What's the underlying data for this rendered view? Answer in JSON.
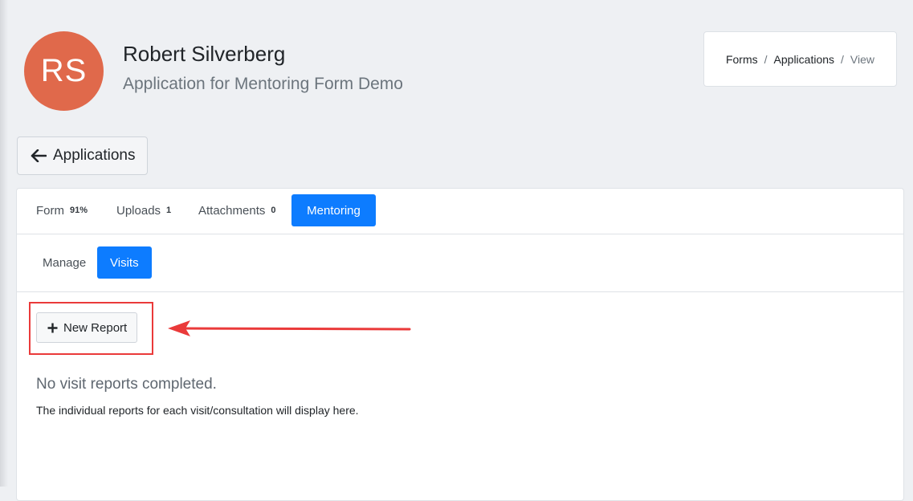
{
  "header": {
    "avatar_initials": "RS",
    "avatar_color": "#e0694b",
    "name": "Robert Silverberg",
    "subtitle": "Application for Mentoring Form Demo"
  },
  "breadcrumb": {
    "items": [
      "Forms",
      "Applications",
      "View"
    ],
    "separator": "/"
  },
  "back_button": {
    "label": "Applications",
    "icon": "arrow-left-icon"
  },
  "tabs": [
    {
      "label": "Form",
      "count": "91%"
    },
    {
      "label": "Uploads",
      "count": "1"
    },
    {
      "label": "Attachments",
      "count": "0"
    },
    {
      "label": "Mentoring",
      "count": null,
      "active": true
    }
  ],
  "subtabs": [
    {
      "label": "Manage"
    },
    {
      "label": "Visits",
      "active": true
    }
  ],
  "actions": {
    "new_report_label": "New Report",
    "new_report_icon": "plus-icon"
  },
  "empty_state": {
    "title": "No visit reports completed.",
    "description": "The individual reports for each visit/consultation will display here."
  },
  "colors": {
    "accent": "#0d7cff",
    "annotation": "#ea3a3a"
  }
}
